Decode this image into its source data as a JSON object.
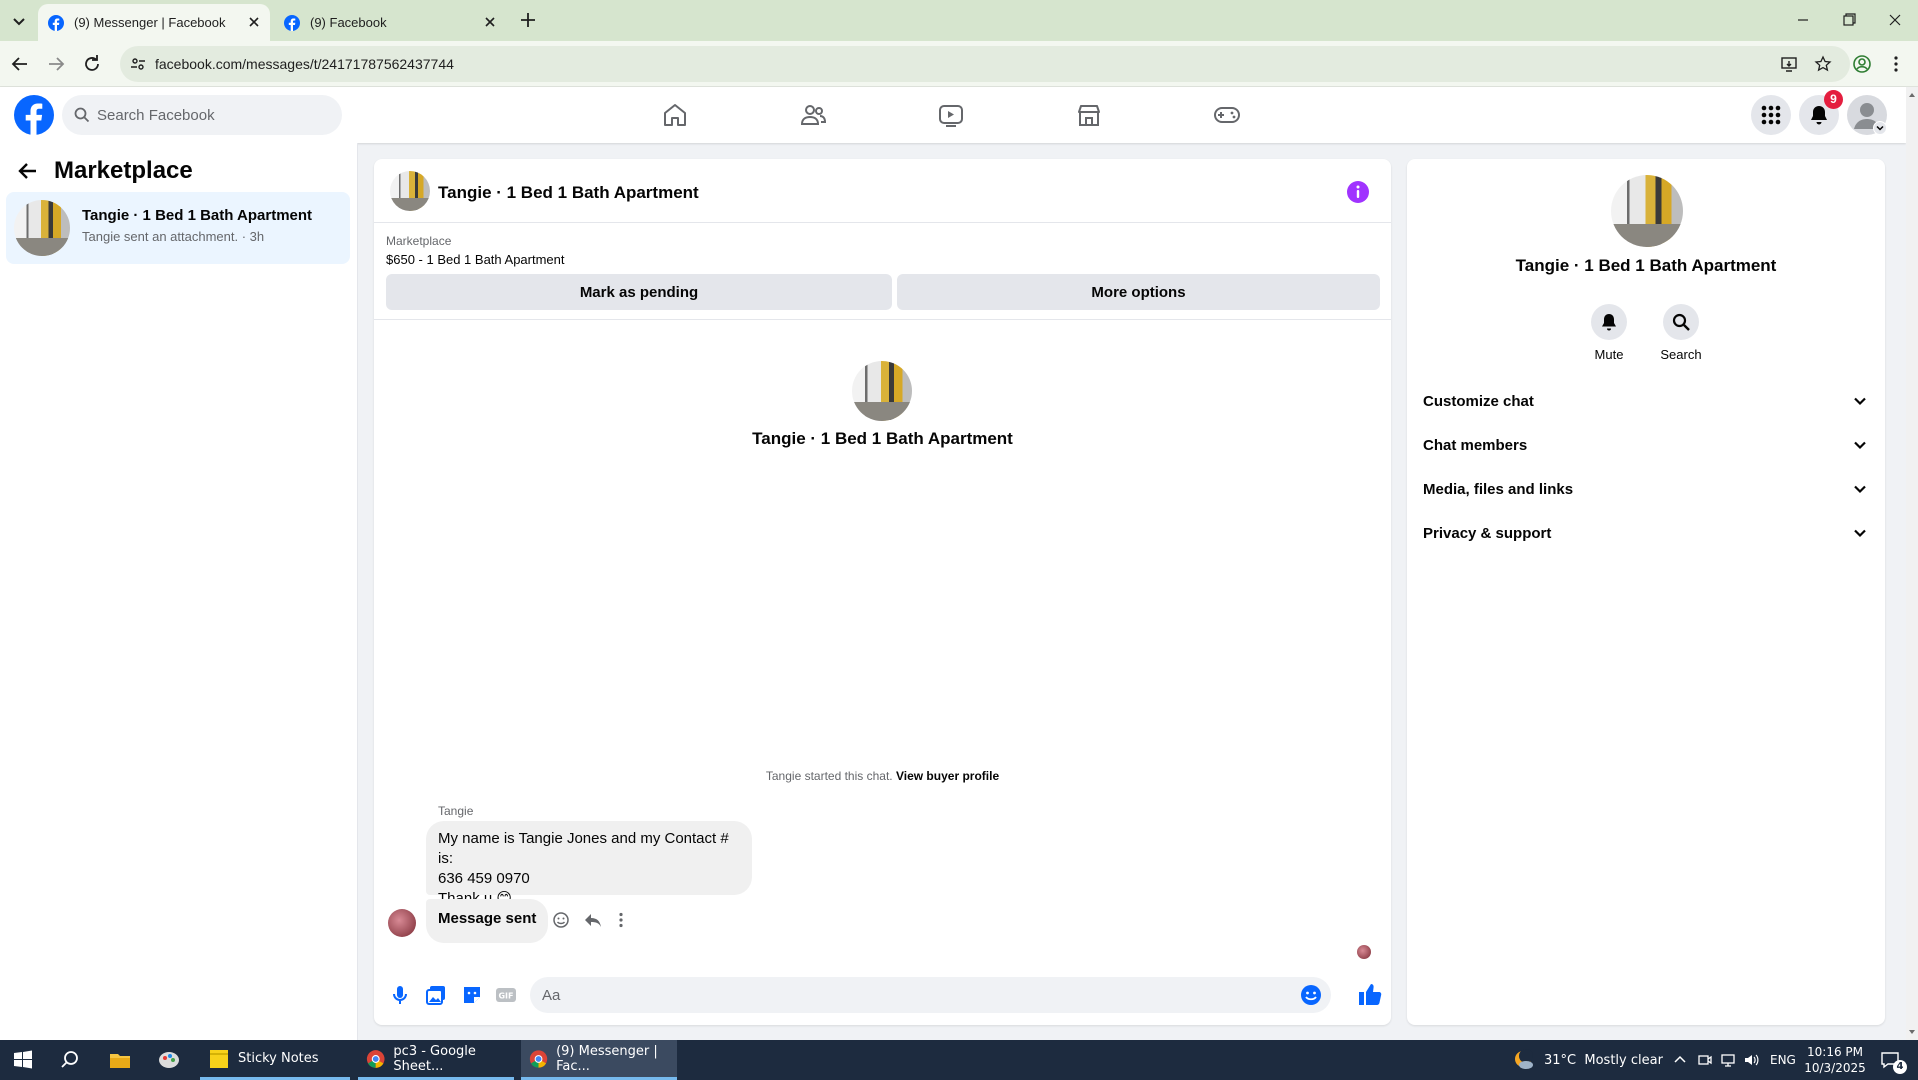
{
  "browser": {
    "tabs": [
      {
        "title": "(9) Messenger | Facebook",
        "active": true
      },
      {
        "title": "(9) Facebook",
        "active": false
      }
    ],
    "url": "facebook.com/messages/t/24171787562437744"
  },
  "header": {
    "search_placeholder": "Search Facebook",
    "notifications_count": "9",
    "nav_icons": [
      "home-icon",
      "friends-icon",
      "watch-icon",
      "marketplace-icon",
      "gaming-icon"
    ]
  },
  "left_panel": {
    "title": "Marketplace",
    "conversations": [
      {
        "name": "Tangie · 1 Bed 1 Bath Apartment",
        "preview": "Tangie sent an attachment. · 3h"
      }
    ]
  },
  "chat": {
    "title": "Tangie · 1 Bed 1 Bath Apartment",
    "marketplace_label": "Marketplace",
    "listing": "$650 - 1 Bed 1 Bath Apartment",
    "mark_pending_label": "Mark as pending",
    "more_options_label": "More options",
    "center_name": "Tangie · 1 Bed 1 Bath Apartment",
    "started_text": "Tangie started this chat.",
    "view_profile_label": "View buyer profile",
    "sender": "Tangie",
    "messages": [
      {
        "line1": "My name is Tangie Jones and my Contact # is:",
        "line2": "636 459 0970",
        "line3": "Thank u 😊"
      },
      {
        "text": "Message sent"
      }
    ],
    "composer_placeholder": "Aa"
  },
  "right_panel": {
    "name": "Tangie · 1 Bed 1 Bath Apartment",
    "actions": [
      {
        "label": "Mute"
      },
      {
        "label": "Search"
      }
    ],
    "sections": [
      {
        "label": "Customize chat"
      },
      {
        "label": "Chat members"
      },
      {
        "label": "Media, files and links"
      },
      {
        "label": "Privacy & support"
      }
    ]
  },
  "taskbar": {
    "apps": [
      {
        "label": "Sticky Notes"
      },
      {
        "label": "pc3 - Google Sheet..."
      },
      {
        "label": "(9) Messenger | Fac..."
      }
    ],
    "weather": "31°C  Mostly clear",
    "language": "ENG",
    "time": "10:16 PM",
    "date": "10/3/2025",
    "notification_count": "4"
  },
  "colors": {
    "fb_blue": "#0866ff",
    "messenger_purple": "#a033ff",
    "badge_red": "#e41e3f"
  }
}
